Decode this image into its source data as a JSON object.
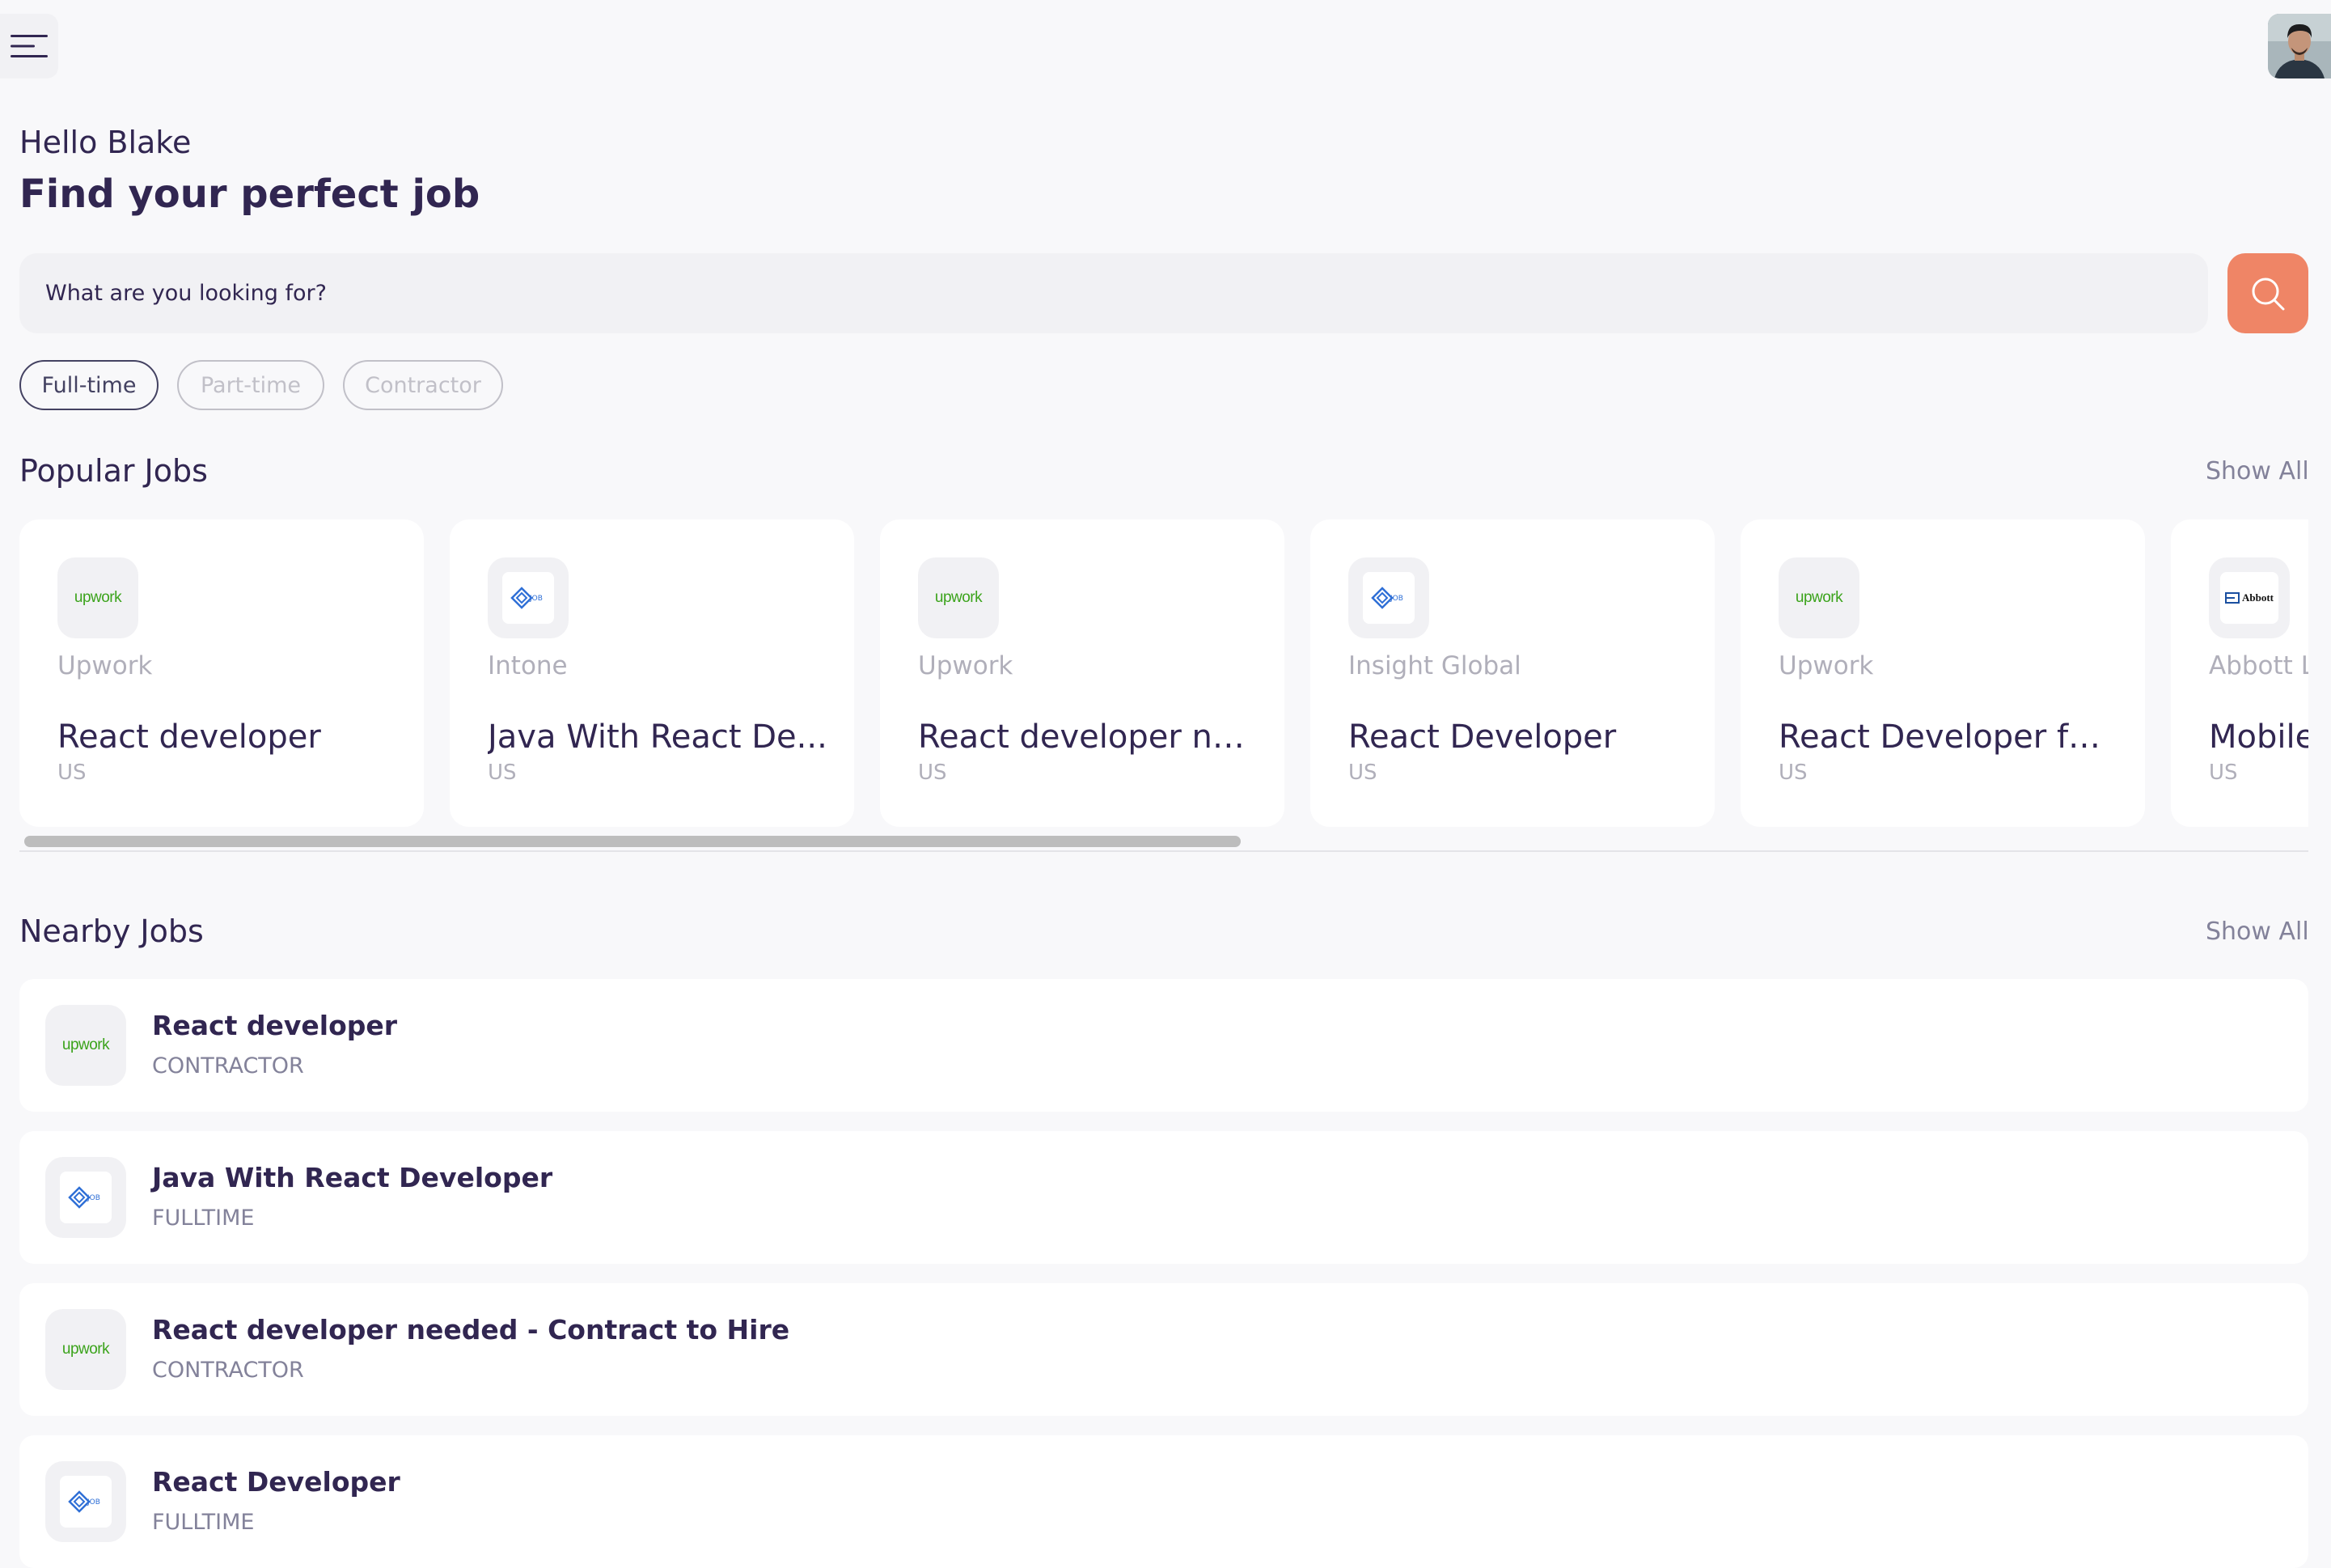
{
  "header": {
    "greeting": "Hello Blake",
    "headline": "Find your perfect job"
  },
  "search": {
    "placeholder": "What are you looking for?"
  },
  "job_types": [
    {
      "label": "Full-time",
      "active": true
    },
    {
      "label": "Part-time",
      "active": false
    },
    {
      "label": "Contractor",
      "active": false
    }
  ],
  "popular": {
    "title": "Popular Jobs",
    "show_all": "Show All",
    "cards": [
      {
        "company": "Upwork",
        "title": "React developer",
        "location": "US",
        "logo": "upwork",
        "logo_text": "upwork"
      },
      {
        "company": "Intone",
        "title": "Java With React De...",
        "location": "US",
        "logo": "job-icon"
      },
      {
        "company": "Upwork",
        "title": "React developer ne...",
        "location": "US",
        "logo": "upwork",
        "logo_text": "upwork"
      },
      {
        "company": "Insight Global",
        "title": "React Developer",
        "location": "US",
        "logo": "job-icon"
      },
      {
        "company": "Upwork",
        "title": "React Developer for...",
        "location": "US",
        "logo": "upwork",
        "logo_text": "upwork"
      },
      {
        "company": "Abbott L",
        "title": "Mobile",
        "location": "US",
        "logo": "abbott",
        "logo_text": "Abbott"
      }
    ]
  },
  "nearby": {
    "title": "Nearby Jobs",
    "show_all": "Show All",
    "rows": [
      {
        "title": "React developer",
        "type": "CONTRACTOR",
        "logo": "upwork",
        "logo_text": "upwork"
      },
      {
        "title": "Java With React Developer",
        "type": "FULLTIME",
        "logo": "job-icon"
      },
      {
        "title": "React developer needed - Contract to Hire",
        "type": "CONTRACTOR",
        "logo": "upwork",
        "logo_text": "upwork"
      },
      {
        "title": "React Developer",
        "type": "FULLTIME",
        "logo": "job-icon"
      }
    ]
  },
  "colors": {
    "background": "#f8f8fa",
    "primary_text": "#312651",
    "accent": "#ef8566",
    "muted": "#83829a",
    "upwork_green": "#3ba31b"
  }
}
